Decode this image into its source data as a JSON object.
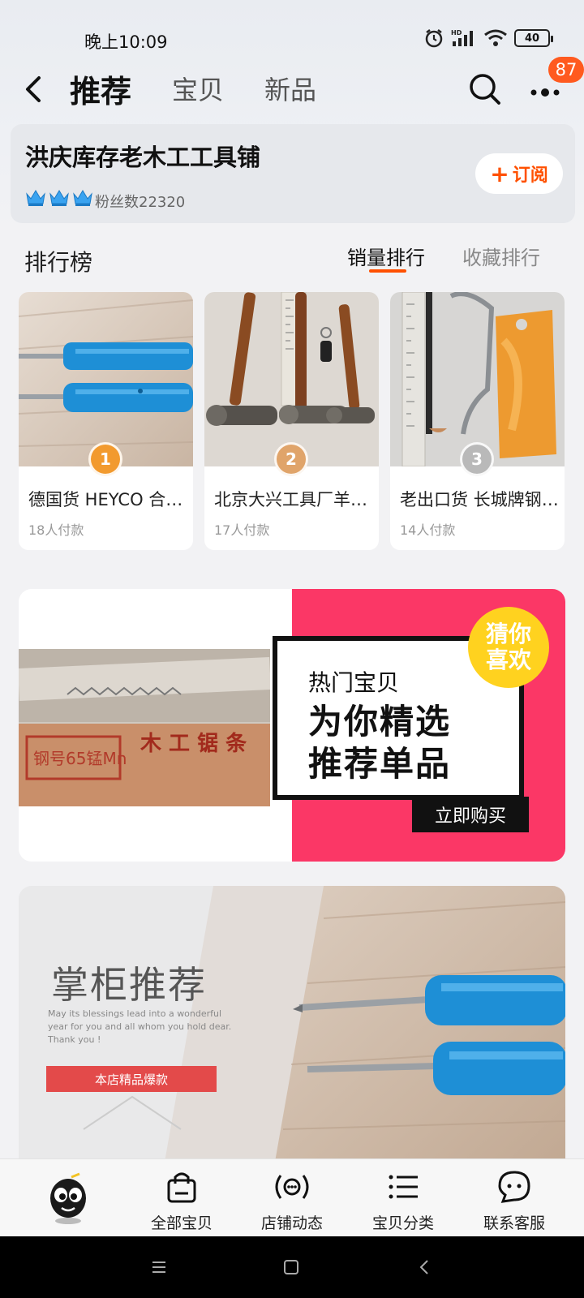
{
  "status_bar": {
    "time": "晚上10:09",
    "battery": "40"
  },
  "nav": {
    "tabs": [
      {
        "label": "推荐"
      },
      {
        "label": "宝贝"
      },
      {
        "label": "新品"
      }
    ],
    "badge_count": "87"
  },
  "shop": {
    "name": "洪庆库存老木工工具铺",
    "fans": "粉丝数22320",
    "subscribe_label": "订阅"
  },
  "ranking": {
    "title": "排行榜",
    "tabs": [
      {
        "label": "销量排行"
      },
      {
        "label": "收藏排行"
      }
    ],
    "items": [
      {
        "rank": "1",
        "title": "德国货 HEYCO 合金钢螺丝刀",
        "sales": "18人付款"
      },
      {
        "rank": "2",
        "title": "北京大兴工具厂羊角锤",
        "sales": "17人付款"
      },
      {
        "rank": "3",
        "title": "老出口货 长城牌钢锯弓",
        "sales": "14人付款"
      }
    ]
  },
  "promo": {
    "small": "热门宝贝",
    "line1": "为你精选",
    "line2": "推荐单品",
    "buy_label": "立即购买",
    "guess_line1": "猜你",
    "guess_line2": "喜欢",
    "photo_text_1": "钢号65锰Mn",
    "photo_text_2": "木 工 锯 条"
  },
  "manager": {
    "title": "掌柜推荐",
    "english": "May its blessings lead into a wonderful year for you and all whom you hold dear. Thank you !",
    "tag": "本店精品爆款"
  },
  "tabbar": {
    "items": [
      {
        "label": "全部宝贝",
        "icon": "shopping-bag-icon"
      },
      {
        "label": "店铺动态",
        "icon": "broadcast-icon"
      },
      {
        "label": "宝贝分类",
        "icon": "list-icon"
      },
      {
        "label": "联系客服",
        "icon": "chat-face-icon"
      }
    ]
  },
  "colors": {
    "accent": "#ff5000",
    "promo_pink": "#fb3766",
    "badge": "#ff5a1f",
    "guess_yellow": "#ffd21f"
  }
}
